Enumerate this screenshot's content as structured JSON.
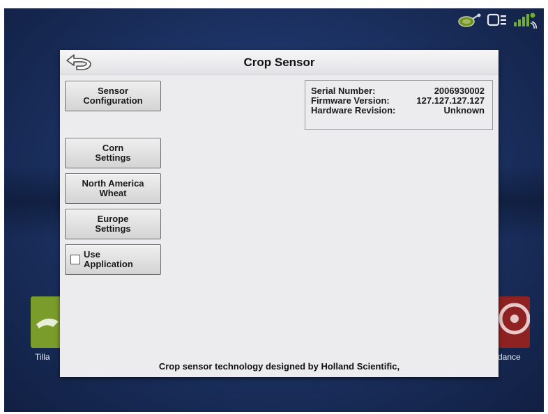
{
  "dialog": {
    "title": "Crop Sensor",
    "back_icon": "back-arrow-icon"
  },
  "buttons": {
    "sensor_configuration": "Sensor\nConfiguration",
    "corn_settings": "Corn\nSettings",
    "north_america_wheat": "North America\nWheat",
    "europe_settings": "Europe\nSettings",
    "use_application": "Use\nApplication",
    "use_application_checked": false
  },
  "info": {
    "serial_number_label": "Serial Number:",
    "serial_number_value": "2006930002",
    "firmware_version_label": "Firmware Version:",
    "firmware_version_value": "127.127.127.127",
    "hardware_revision_label": "Hardware Revision:",
    "hardware_revision_value": "Unknown"
  },
  "footer": "Crop sensor technology designed by Holland Scientific,",
  "background": {
    "left_tile_label": "Tilla",
    "right_tile_label": "dance",
    "left_tile_color": "#7a9c2a",
    "right_tile_color": "#8e2222"
  },
  "status_bar": {
    "icons": [
      "sensor-icon",
      "module-icon",
      "gps-signal-icon"
    ]
  }
}
